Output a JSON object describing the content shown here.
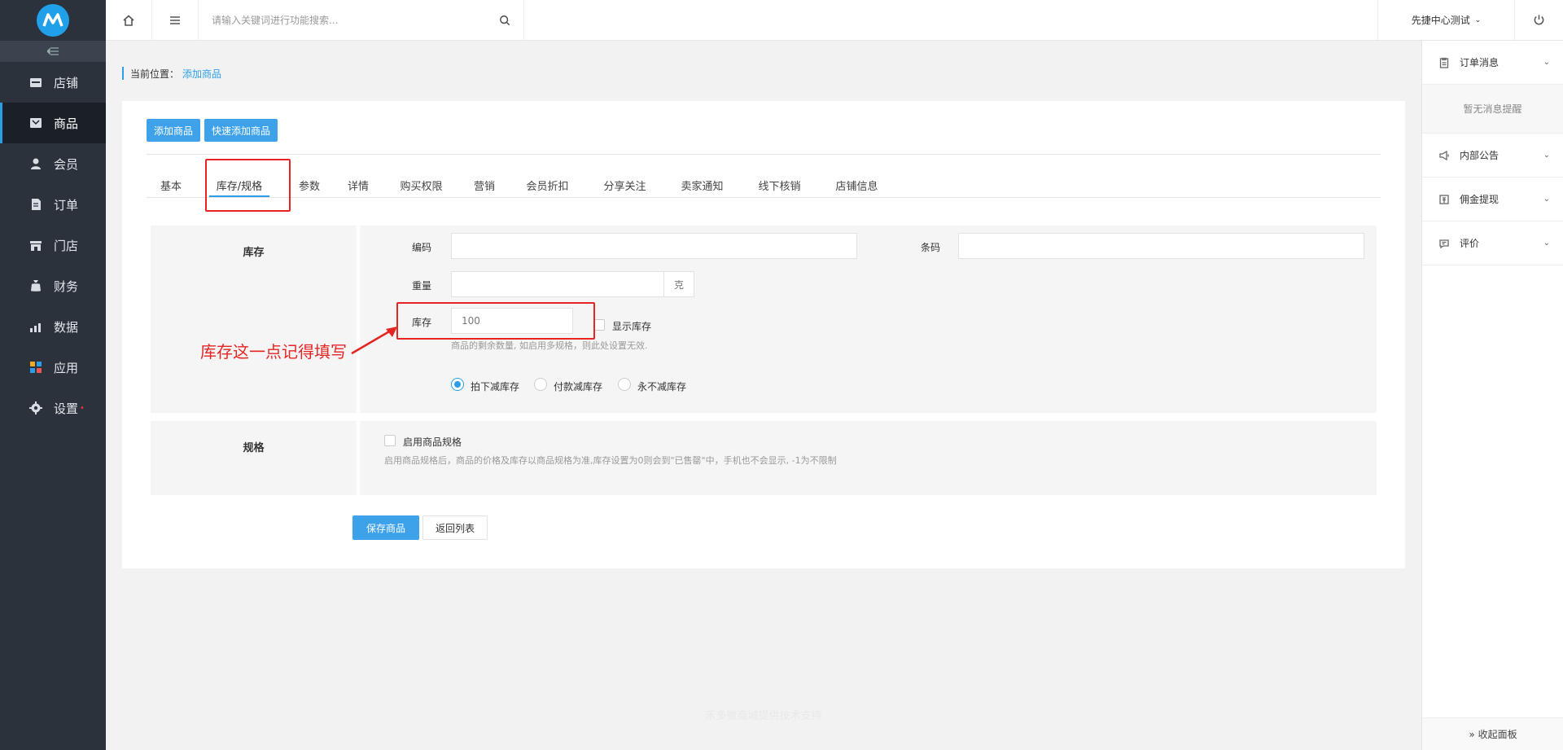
{
  "sidebar": {
    "items": [
      {
        "label": "店铺",
        "icon": "store-icon"
      },
      {
        "label": "商品",
        "icon": "goods-icon",
        "active": true
      },
      {
        "label": "会员",
        "icon": "member-icon"
      },
      {
        "label": "订单",
        "icon": "order-icon"
      },
      {
        "label": "门店",
        "icon": "shop-icon"
      },
      {
        "label": "财务",
        "icon": "finance-icon"
      },
      {
        "label": "数据",
        "icon": "data-icon"
      },
      {
        "label": "应用",
        "icon": "apps-icon"
      },
      {
        "label": "设置",
        "icon": "settings-icon",
        "dot": "•"
      }
    ]
  },
  "topbar": {
    "search_placeholder": "请输入关键词进行功能搜索...",
    "shop_switch": "先捷中心测试"
  },
  "breadcrumb": {
    "prefix": "当前位置：",
    "current": "添加商品"
  },
  "buttons": {
    "add_goods": "添加商品",
    "quick_add": "快速添加商品",
    "save": "保存商品",
    "back": "返回列表"
  },
  "tabs": [
    "基本",
    "库存/规格",
    "参数",
    "详情",
    "购买权限",
    "营销",
    "会员折扣",
    "分享关注",
    "卖家通知",
    "线下核销",
    "店铺信息"
  ],
  "active_tab": "库存/规格",
  "stock_section": {
    "title": "库存",
    "code_label": "编码",
    "barcode_label": "条码",
    "weight_label": "重量",
    "weight_unit": "克",
    "stock_label": "库存",
    "stock_value": "100",
    "show_stock_label": "显示库存",
    "stock_hint": "商品的剩余数量, 如启用多规格，则此处设置无效.",
    "reduce_options": [
      "拍下减库存",
      "付款减库存",
      "永不减库存"
    ],
    "reduce_selected": "拍下减库存"
  },
  "spec_section": {
    "title": "规格",
    "enable_label": "启用商品规格",
    "hint": "启用商品规格后，商品的价格及库存以商品规格为准,库存设置为0则会到\"已售罄\"中，手机也不会显示, -1为不限制"
  },
  "annotation": {
    "text": "库存这一点记得填写",
    "color": "#e62424"
  },
  "right_panel": {
    "items": [
      {
        "label": "订单消息",
        "icon": "clipboard-icon"
      },
      {
        "label": "内部公告",
        "icon": "megaphone-icon"
      },
      {
        "label": "佣金提现",
        "icon": "wallet-icon"
      },
      {
        "label": "评价",
        "icon": "comment-icon"
      }
    ],
    "empty_text": "暂无消息提醒",
    "footer": "» 收起面板"
  },
  "footer_text": "禾多微商城提供技术支持",
  "colors": {
    "accent": "#2c9ee9",
    "sidebar_bg": "#2b323c",
    "annotation_red": "#e62424"
  }
}
